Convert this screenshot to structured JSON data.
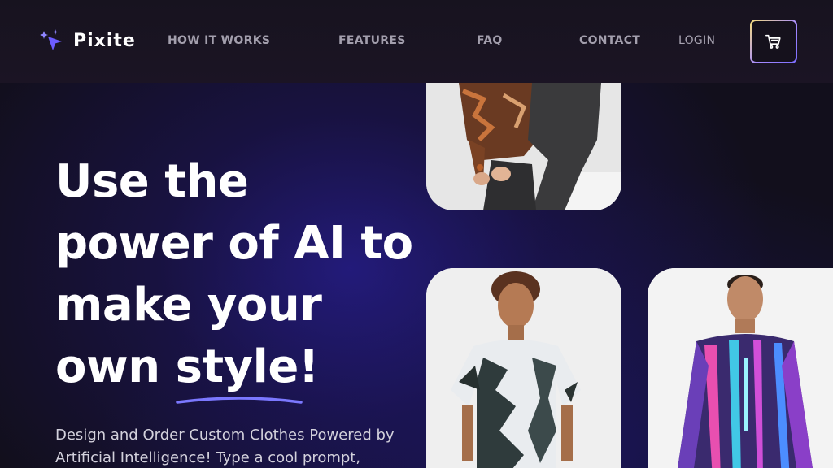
{
  "brand": {
    "name": "Pixite",
    "icon": "sparkle-cursor-icon",
    "accent": "#6c5cff"
  },
  "nav": {
    "items": [
      {
        "label": "HOW IT WORKS"
      },
      {
        "label": "FEATURES"
      },
      {
        "label": "FAQ"
      },
      {
        "label": "CONTACT"
      }
    ],
    "login": "LOGIN",
    "cart_icon": "cart-icon"
  },
  "hero": {
    "headline_lines": [
      "Use the",
      "power of AI to",
      "make your",
      "own "
    ],
    "highlight_word": "style",
    "highlight_suffix": "!",
    "subtext": "Design and Order Custom Clothes Powered by Artificial Intelligence! Type a cool prompt,",
    "underline_color": "#7b78ff"
  },
  "gallery": {
    "images": [
      {
        "name": "model-seated-patterned-sweater"
      },
      {
        "name": "model-tie-dye-tshirt"
      },
      {
        "name": "model-neon-city-sweater"
      }
    ]
  }
}
